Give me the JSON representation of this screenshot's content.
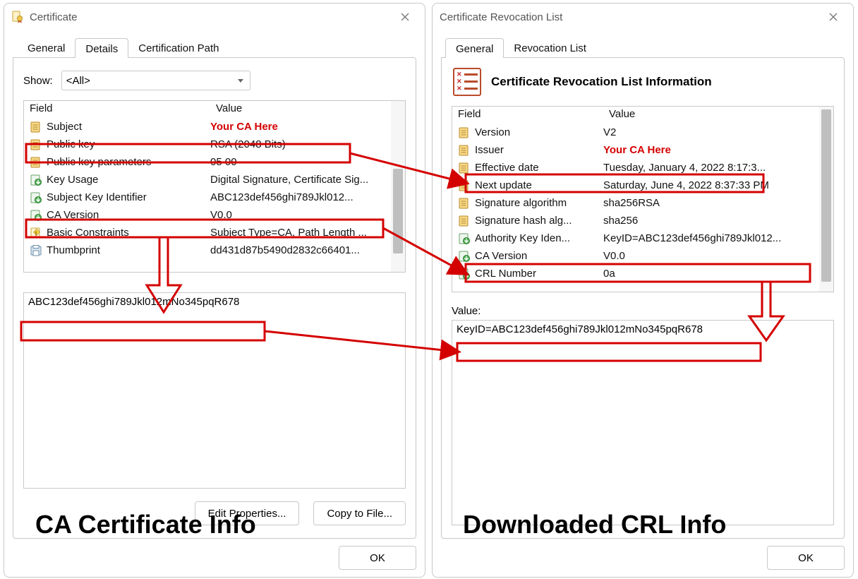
{
  "colors": {
    "annotation": "#d40000"
  },
  "cert": {
    "title": "Certificate",
    "tabs": {
      "general": "General",
      "details": "Details",
      "certpath": "Certification Path",
      "active": "Details"
    },
    "show": {
      "label": "Show:",
      "value": "<All>"
    },
    "headers": {
      "field": "Field",
      "value": "Value"
    },
    "rows": [
      {
        "icon": "doc",
        "field": "Subject",
        "value": "Your CA Here"
      },
      {
        "icon": "doc",
        "field": "Public key",
        "value": "RSA (2048 Bits)"
      },
      {
        "icon": "doc",
        "field": "Public key parameters",
        "value": "05 00"
      },
      {
        "icon": "ext",
        "field": "Key Usage",
        "value": "Digital Signature, Certificate Sig..."
      },
      {
        "icon": "ext",
        "field": "Subject Key Identifier",
        "value": "ABC123def456ghi789Jkl012..."
      },
      {
        "icon": "ext",
        "field": "CA Version",
        "value": "V0.0"
      },
      {
        "icon": "crit",
        "field": "Basic Constraints",
        "value": "Subject Type=CA, Path Length ..."
      },
      {
        "icon": "print",
        "field": "Thumbprint",
        "value": "dd431d87b5490d2832c66401..."
      }
    ],
    "valuebox": "ABC123def456ghi789Jkl012mNo345pqR678",
    "buttons": {
      "edit": "Edit Properties...",
      "copy": "Copy to File...",
      "ok": "OK"
    }
  },
  "crl": {
    "title": "Certificate Revocation List",
    "tabs": {
      "general": "General",
      "revlist": "Revocation List",
      "active": "General"
    },
    "section_title": "Certificate Revocation List Information",
    "headers": {
      "field": "Field",
      "value": "Value"
    },
    "rows": [
      {
        "icon": "doc",
        "field": "Version",
        "value": "V2"
      },
      {
        "icon": "doc",
        "field": "Issuer",
        "value": "Your CA Here"
      },
      {
        "icon": "doc",
        "field": "Effective date",
        "value": "Tuesday, January 4, 2022 8:17:3..."
      },
      {
        "icon": "doc",
        "field": "Next update",
        "value": "Saturday, June 4, 2022 8:37:33 PM"
      },
      {
        "icon": "doc",
        "field": "Signature algorithm",
        "value": "sha256RSA"
      },
      {
        "icon": "doc",
        "field": "Signature hash alg...",
        "value": "sha256"
      },
      {
        "icon": "ext",
        "field": "Authority Key Iden...",
        "value": "KeyID=ABC123def456ghi789Jkl012..."
      },
      {
        "icon": "ext",
        "field": "CA Version",
        "value": "V0.0"
      },
      {
        "icon": "ext",
        "field": "CRL Number",
        "value": "0a"
      }
    ],
    "value_label": "Value:",
    "valuebox": "KeyID=ABC123def456ghi789Jkl012mNo345pqR678",
    "buttons": {
      "ok": "OK"
    }
  },
  "annotations": {
    "left_caption": "CA Certificate Info",
    "right_caption": "Downloaded CRL Info"
  }
}
